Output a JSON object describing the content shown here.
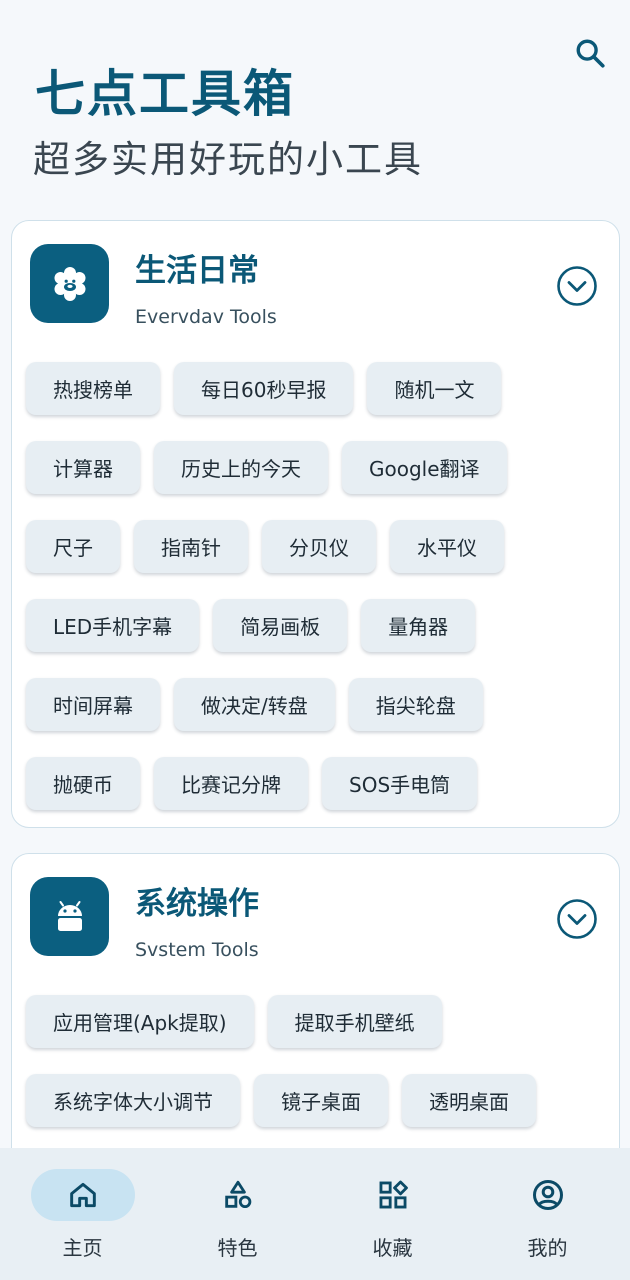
{
  "header": {
    "title": "七点工具箱",
    "subtitle": "超多实用好玩的小工具"
  },
  "icons": {
    "search": "search-icon",
    "life_category": "flower-face-icon",
    "system_category": "android-icon",
    "expand": "chevron-down-circle-icon"
  },
  "colors": {
    "primary": "#0b5877",
    "icon_bg": "#0b5f80",
    "chip_bg": "#e7eef3",
    "nav_bg": "#e8eff4",
    "nav_active_pill": "#c8e3f2"
  },
  "categories": [
    {
      "title": "生活日常",
      "subtitle": "Evervdav Tools",
      "rows": [
        [
          "热搜榜单",
          "每日60秒早报",
          "随机一文"
        ],
        [
          "计算器",
          "历史上的今天",
          "Google翻译"
        ],
        [
          "尺子",
          "指南针",
          "分贝仪",
          "水平仪"
        ],
        [
          "LED手机字幕",
          "简易画板",
          "量角器"
        ],
        [
          "时间屏幕",
          "做决定/转盘",
          "指尖轮盘"
        ],
        [
          "抛硬币",
          "比赛记分牌",
          "SOS手电筒"
        ]
      ]
    },
    {
      "title": "系统操作",
      "subtitle": "Svstem Tools",
      "rows": [
        [
          "应用管理(Apk提取)",
          "提取手机壁纸"
        ],
        [
          "系统字体大小调节",
          "镜子桌面",
          "透明桌面"
        ]
      ]
    }
  ],
  "bottom_nav": {
    "items": [
      {
        "label": "主页",
        "icon": "home-icon",
        "active": true
      },
      {
        "label": "特色",
        "icon": "shapes-icon",
        "active": false
      },
      {
        "label": "收藏",
        "icon": "apps-icon",
        "active": false
      },
      {
        "label": "我的",
        "icon": "account-icon",
        "active": false
      }
    ]
  }
}
